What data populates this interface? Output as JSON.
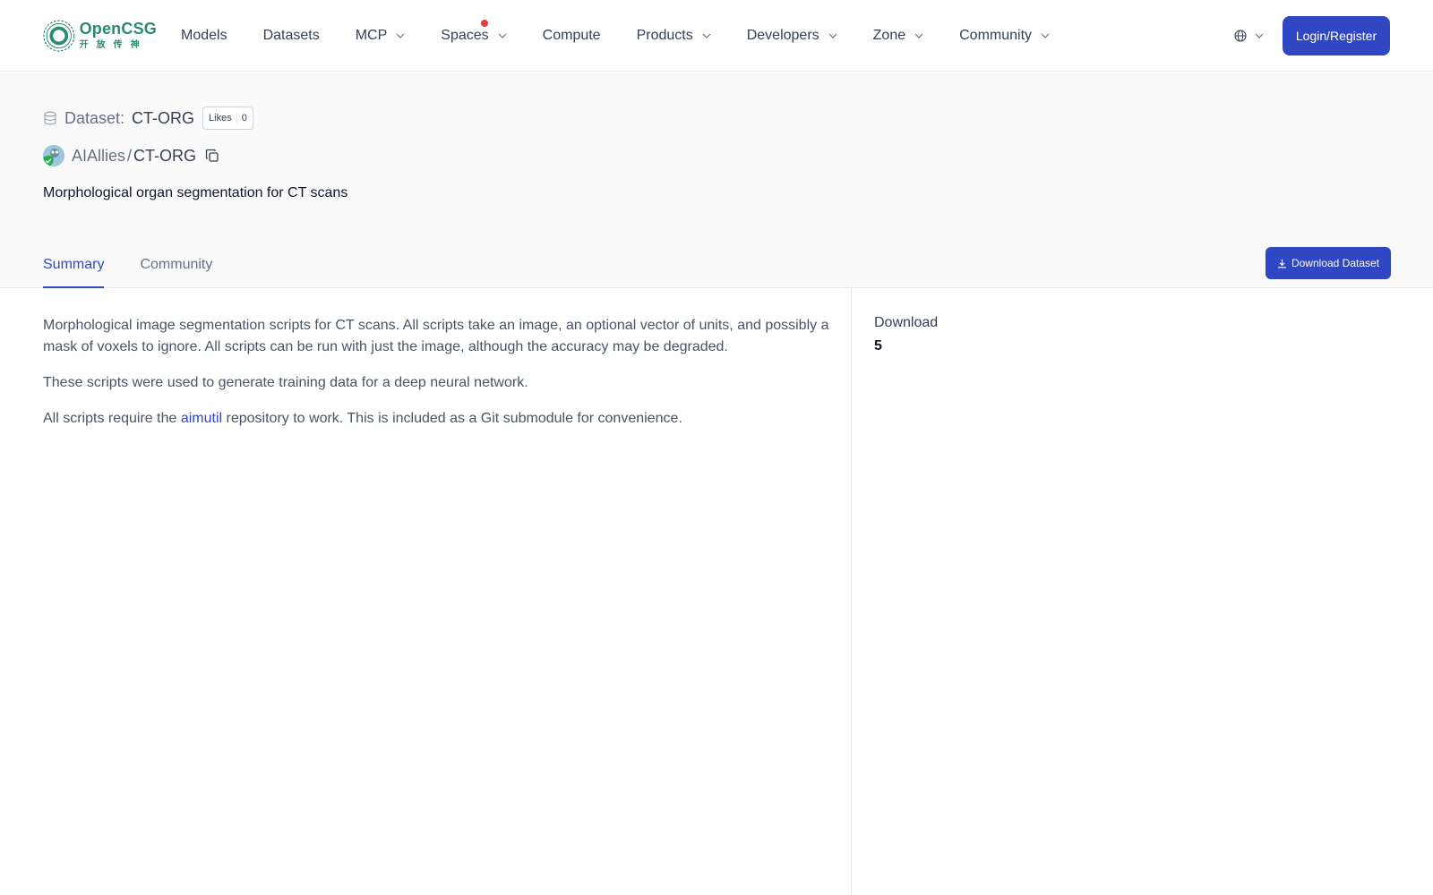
{
  "brand": {
    "name": "OpenCSG",
    "subtitle": "开放传神",
    "color": "#2a8a73"
  },
  "nav": {
    "items": [
      {
        "label": "Models",
        "has_dropdown": false
      },
      {
        "label": "Datasets",
        "has_dropdown": false
      },
      {
        "label": "MCP",
        "has_dropdown": true
      },
      {
        "label": "Spaces",
        "has_dropdown": true,
        "badge": "red-dot"
      },
      {
        "label": "Compute",
        "has_dropdown": false
      },
      {
        "label": "Products",
        "has_dropdown": true
      },
      {
        "label": "Developers",
        "has_dropdown": true
      },
      {
        "label": "Zone",
        "has_dropdown": true
      },
      {
        "label": "Community",
        "has_dropdown": true
      }
    ],
    "language_icon": "globe-icon",
    "login_label": "Login/Register"
  },
  "dataset": {
    "type_label": "Dataset:",
    "name": "CT-ORG",
    "likes_label": "Likes",
    "likes_count": "0",
    "owner": "AIAllies",
    "path_separator": "/",
    "repo": "CT-ORG",
    "description": "Morphological organ segmentation for CT scans"
  },
  "tabs": [
    {
      "label": "Summary",
      "active": true
    },
    {
      "label": "Community",
      "active": false
    }
  ],
  "actions": {
    "download_label": "Download Dataset"
  },
  "summary": {
    "paragraphs": [
      "Morphological image segmentation scripts for CT scans. All scripts take an image, an optional vector of units, and possibly a mask of voxels to ignore. All scripts can be run with just the image, although the accuracy may be degraded.",
      "These scripts were used to generate training data for a deep neural network."
    ],
    "p3_before": "All scripts require the ",
    "p3_link": "aimutil",
    "p3_after": " repository to work. This is included as a Git submodule for convenience."
  },
  "stats": {
    "download_label": "Download",
    "download_count": "5"
  },
  "colors": {
    "primary": "#2f47c2",
    "badge": "#e63b3b"
  }
}
